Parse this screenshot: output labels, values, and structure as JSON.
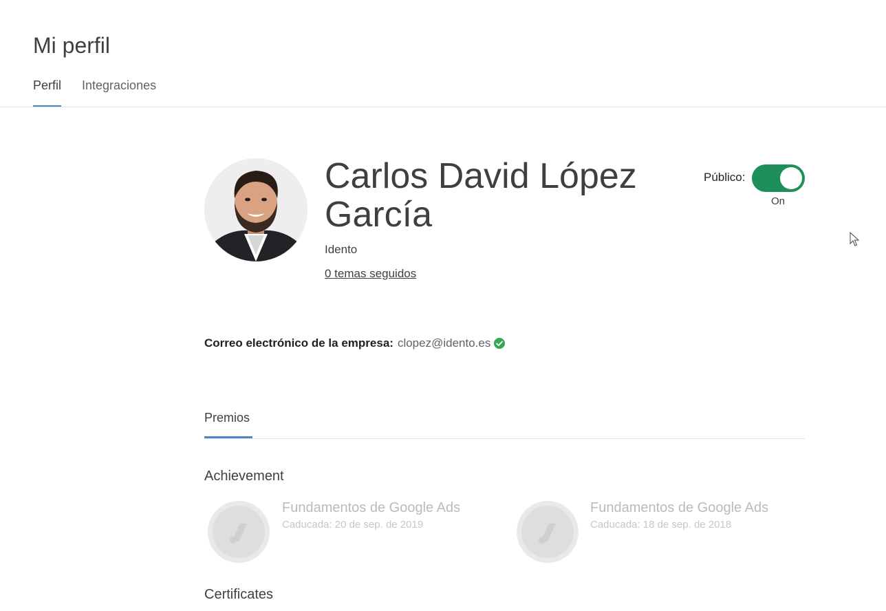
{
  "header": {
    "title": "Mi perfil",
    "tabs": [
      {
        "label": "Perfil",
        "active": true
      },
      {
        "label": "Integraciones",
        "active": false
      }
    ]
  },
  "profile": {
    "name": "Carlos David López García",
    "company": "Idento",
    "topics_link": "0 temas seguidos",
    "public_label": "Público:",
    "public_state": "On",
    "public_enabled": true,
    "email_label": "Correo electrónico de la empresa:",
    "email_value": "clopez@idento.es"
  },
  "awards": {
    "tab_label": "Premios",
    "achievement_heading": "Achievement",
    "items": [
      {
        "title": "Fundamentos de Google Ads",
        "date": "Caducada: 20 de sep. de 2019"
      },
      {
        "title": "Fundamentos de Google Ads",
        "date": "Caducada: 18 de sep. de 2018"
      }
    ],
    "certificates_heading": "Certificates"
  },
  "colors": {
    "accent": "#4a86c0",
    "toggle_on": "#1e8e5a",
    "verified": "#34a853"
  }
}
